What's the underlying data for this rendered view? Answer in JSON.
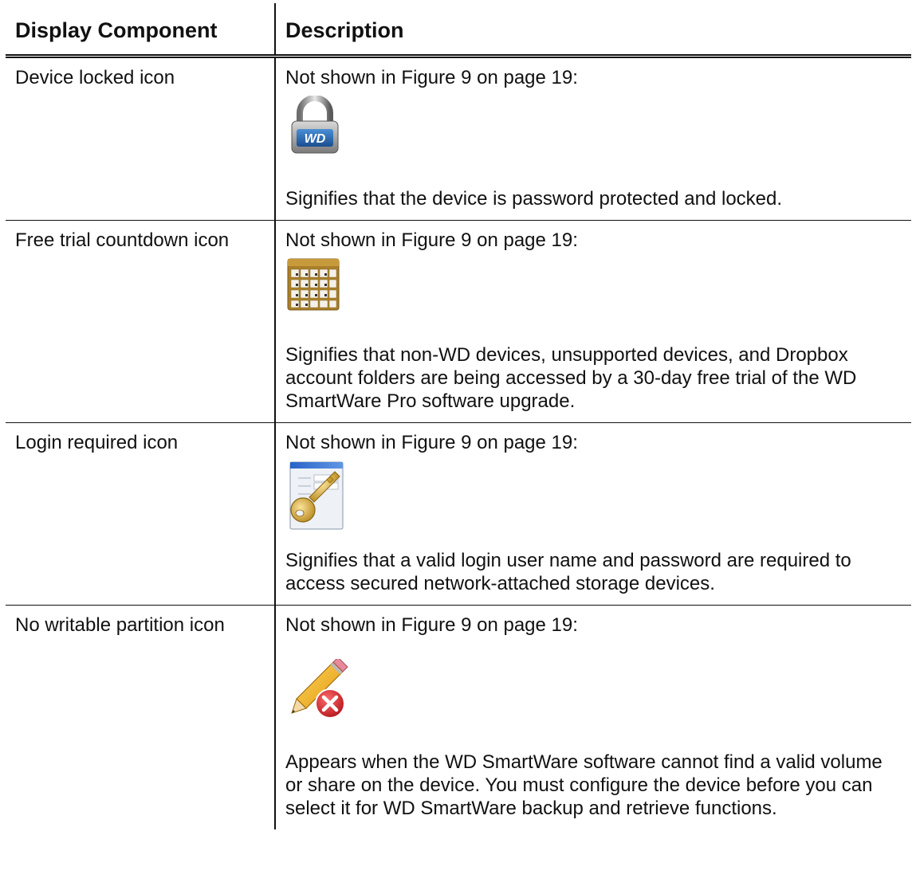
{
  "table": {
    "headers": [
      "Display Component",
      "Description"
    ],
    "rows": [
      {
        "component": "Device locked icon",
        "intro": "Not shown in Figure 9 on page 19:",
        "icon": "padlock-wd-icon",
        "icon_text": "WD",
        "description": "Signifies that the device is password protected and locked."
      },
      {
        "component": "Free trial countdown icon",
        "intro": "Not shown in Figure 9 on page 19:",
        "icon": "calendar-icon",
        "description": "Signifies that non-WD devices, unsupported devices, and Dropbox account folders are being accessed by a 30-day free trial of the WD SmartWare Pro software upgrade."
      },
      {
        "component": "Login required icon",
        "intro": "Not shown in Figure 9 on page 19:",
        "icon": "key-window-icon",
        "description": "Signifies that a valid login user name and password are required to access secured network-attached storage devices."
      },
      {
        "component": "No writable partition icon",
        "intro": "Not shown in Figure 9 on page 19:",
        "icon": "pencil-error-icon",
        "description": "Appears when the WD SmartWare software cannot find a valid volume or share on the device. You must configure the device before you can select it for WD SmartWare backup and retrieve functions."
      }
    ]
  },
  "colors": {
    "rule": "#111111",
    "lock_blue": "#1f5fa8",
    "calendar_gold": "#a97f2a",
    "error_red": "#d2232a",
    "key_gold": "#d9a928"
  }
}
